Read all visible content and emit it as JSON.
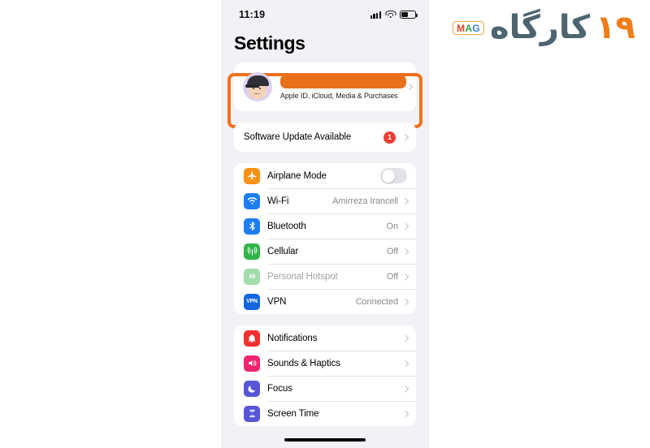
{
  "brand": {
    "mag_m": "M",
    "mag_a": "A",
    "mag_g": "G",
    "word": "کارگاه",
    "number": "۱۹",
    "word_color": "#4d6470",
    "number_color": "#f07d1a"
  },
  "highlight": {
    "color": "#f2711c"
  },
  "status_bar": {
    "time": "11:19",
    "signal_icon": "cellular-signal-icon",
    "wifi_icon": "wifi-icon",
    "battery_icon": "battery-icon"
  },
  "page_title": "Settings",
  "apple_id": {
    "avatar_icon": "memoji-avatar",
    "name_redacted": "",
    "subtitle": "Apple ID, iCloud, Media & Purchases",
    "redact_color": "#e8701a",
    "chevron_icon": "chevron-right-icon"
  },
  "software_update": {
    "label": "Software Update Available",
    "badge": "1",
    "badge_color": "#ef3b30",
    "chevron_icon": "chevron-right-icon"
  },
  "connectivity": {
    "rows": [
      {
        "label": "Airplane Mode",
        "value": "",
        "icon": "airplane-icon",
        "icon_color": "#f79213",
        "control": "toggle",
        "toggle_on": false,
        "dim": false
      },
      {
        "label": "Wi-Fi",
        "value": "Amirreza Irancell",
        "icon": "wifi-icon",
        "icon_color": "#1d7df2",
        "control": "chevron",
        "dim": false
      },
      {
        "label": "Bluetooth",
        "value": "On",
        "icon": "bluetooth-icon",
        "icon_color": "#1d7df2",
        "control": "chevron",
        "dim": false
      },
      {
        "label": "Cellular",
        "value": "Off",
        "icon": "cellular-antenna-icon",
        "icon_color": "#32b44a",
        "control": "chevron",
        "dim": false
      },
      {
        "label": "Personal Hotspot",
        "value": "Off",
        "icon": "hotspot-link-icon",
        "icon_color": "#32b44a",
        "control": "chevron",
        "dim": true
      },
      {
        "label": "VPN",
        "value": "Connected",
        "icon": "vpn-icon",
        "icon_color": "#1266e0",
        "control": "chevron",
        "dim": false
      }
    ]
  },
  "notifications_group": {
    "rows": [
      {
        "label": "Notifications",
        "value": "",
        "icon": "bell-icon",
        "icon_color": "#f23030",
        "dim": false
      },
      {
        "label": "Sounds & Haptics",
        "value": "",
        "icon": "speaker-icon",
        "icon_color": "#f0256f",
        "dim": false
      },
      {
        "label": "Focus",
        "value": "",
        "icon": "moon-icon",
        "icon_color": "#5856d6",
        "dim": false
      }
    ],
    "partial_row": {
      "label": "Screen Time",
      "icon": "hourglass-icon",
      "icon_color": "#5856d6"
    }
  }
}
